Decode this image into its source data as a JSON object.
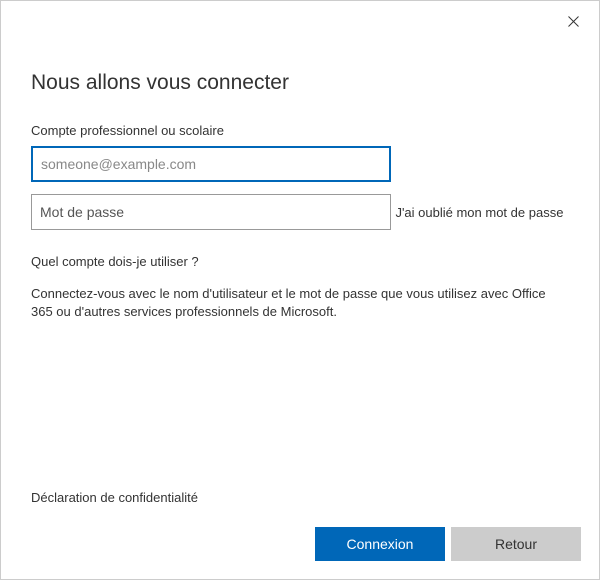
{
  "title": "Nous allons vous connecter",
  "account_label": "Compte professionnel ou scolaire",
  "email_placeholder": "someone@example.com",
  "email_value": "",
  "password_placeholder": "Mot de passe",
  "password_value": "",
  "forgot_password": "J'ai oublié mon mot de passe",
  "which_account": "Quel compte dois-je utiliser ?",
  "description": "Connectez-vous avec le nom d'utilisateur et le mot de passe que vous utilisez avec Office 365 ou d'autres services professionnels de Microsoft.",
  "privacy_link": "Déclaration de confidentialité",
  "buttons": {
    "signin": "Connexion",
    "back": "Retour"
  }
}
